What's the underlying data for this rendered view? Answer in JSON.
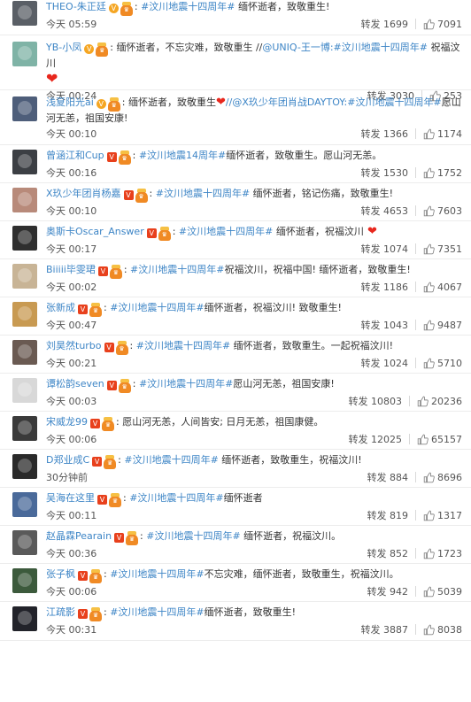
{
  "labels": {
    "repost": "转发"
  },
  "comments": [
    {
      "user": "THEO-朱正廷",
      "badge": "gold",
      "tag": "#汶川地震十四周年#",
      "text": " 缅怀逝者，致敬重生!",
      "time": "今天 05:59",
      "repost": "1699",
      "likes": "7091",
      "avatar": "#5a5f66"
    },
    {
      "user": "YB-小凤",
      "badge": "gold",
      "text": "缅怀逝者，不忘灾难，致敬重生 //",
      "mention": "@UNIQ-王一博",
      "tag": ":#汶川地震十四周年#",
      "text2": " 祝福汶川",
      "time": "今天 00:24",
      "repost": "3030",
      "likes": "253",
      "avatar": "#7fb3a6"
    },
    {
      "user": "浅夏阳光ai",
      "badge": "gold",
      "text": "缅怀逝者，致敬重生",
      "mention": "//@X玖少年团肖战DAYTOY:",
      "tag": "#汶川地震十四周年#",
      "text2": "愿山河无恙，祖国安康!",
      "time": "今天 00:10",
      "repost": "1366",
      "likes": "1174",
      "avatar": "#4e5e7a"
    },
    {
      "user": "曾涵江和Cup",
      "badge": "vip",
      "text": "缅怀逝者，致敬重生。愿山河无恙。",
      "tag": "#汶川地震14周年#",
      "time": "今天 00:16",
      "repost": "1530",
      "likes": "1752",
      "avatar": "#3c3f44"
    },
    {
      "user": "X玖少年团肖杨嘉",
      "badge": "vip",
      "tag": "#汶川地震十四周年#",
      "text": " 缅怀逝者，铭记伤痛，致敬重生!",
      "time": "今天 00:10",
      "repost": "4653",
      "likes": "7603",
      "avatar": "#b88a7a"
    },
    {
      "user": "奥斯卡Oscar_Answer",
      "badge": "vip",
      "tag": "#汶川地震十四周年#",
      "text": " 缅怀逝者，祝福汶川",
      "heart": true,
      "time": "今天 00:17",
      "repost": "1074",
      "likes": "7351",
      "avatar": "#2f2f2f"
    },
    {
      "user": "Biiiii毕雯珺",
      "badge": "vip",
      "tag": "#汶川地震十四周年#",
      "text": "祝福汶川，祝福中国! 缅怀逝者，致敬重生!",
      "time": "今天 00:02",
      "repost": "1186",
      "likes": "4067",
      "avatar": "#c8b496"
    },
    {
      "user": "张新成",
      "badge": "vip",
      "tag": "#汶川地震十四周年#",
      "text": "缅怀逝者，祝福汶川! 致敬重生!",
      "time": "今天 00:47",
      "repost": "1043",
      "likes": "9487",
      "avatar": "#c89a52"
    },
    {
      "user": "刘昊然turbo",
      "badge": "vip",
      "tag": "#汶川地震十四周年#",
      "text": " 缅怀逝者，致敬重生。一起祝福汶川!",
      "time": "今天 00:21",
      "repost": "1024",
      "likes": "5710",
      "avatar": "#6a5a52"
    },
    {
      "user": "谭松韵seven",
      "badge": "vip",
      "tag": "#汶川地震十四周年#",
      "text": "愿山河无恙，祖国安康!",
      "time": "今天 00:03",
      "repost": "10803",
      "likes": "20236",
      "avatar": "#d8d8d8"
    },
    {
      "user": "宋威龙99",
      "badge": "vip",
      "text": "愿山河无恙，人间皆安; 日月无恙，祖国康健。",
      "time": "今天 00:06",
      "repost": "12025",
      "likes": "65157",
      "avatar": "#3a3a3a"
    },
    {
      "user": "D郑业成C",
      "badge": "vip",
      "tag": "#汶川地震十四周年#",
      "text": " 缅怀逝者，致敬重生，祝福汶川!",
      "time": "30分钟前",
      "repost": "884",
      "likes": "8696",
      "avatar": "#2a2a2a"
    },
    {
      "user": "吴海在这里",
      "badge": "vip",
      "tag": "#汶川地震十四周年#",
      "text": "缅怀逝者",
      "time": "今天 00:11",
      "repost": "819",
      "likes": "1317",
      "avatar": "#4a6a9a"
    },
    {
      "user": "赵晶霖Pearain",
      "badge": "vip",
      "tag": "#汶川地震十四周年#",
      "text": " 缅怀逝者，祝福汶川。",
      "time": "今天 00:36",
      "repost": "852",
      "likes": "1723",
      "avatar": "#5a5a5a"
    },
    {
      "user": "张子枫",
      "badge": "vip",
      "tag": "#汶川地震十四周年#",
      "text": "不忘灾难，缅怀逝者，致敬重生，祝福汶川。",
      "time": "今天 00:06",
      "repost": "942",
      "likes": "5039",
      "avatar": "#3c5a3c"
    },
    {
      "user": "江疏影",
      "badge": "vip",
      "tag": "#汶川地震十四周年#",
      "text": "缅怀逝者，致敬重生!",
      "time": "今天 00:31",
      "repost": "3887",
      "likes": "8038",
      "avatar": "#22232a"
    }
  ]
}
